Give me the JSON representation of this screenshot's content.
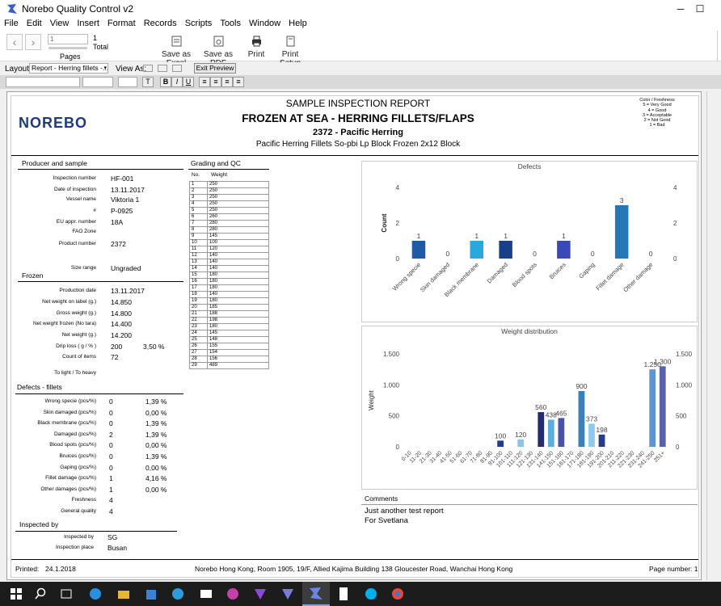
{
  "window": {
    "title": "Norebo Quality Control v2",
    "minimize": "─",
    "maximize": "☐"
  },
  "menu": [
    "File",
    "Edit",
    "View",
    "Insert",
    "Format",
    "Records",
    "Scripts",
    "Tools",
    "Window",
    "Help"
  ],
  "toolbar": {
    "record_value": "1",
    "record_total": "1",
    "total_label": "Total",
    "pages_label": "Pages",
    "save_excel": "Save as Excel",
    "save_pdf": "Save as PDF",
    "print": "Print",
    "print_setup": "Print Setup"
  },
  "layoutbar": {
    "layout_label": "Layout:",
    "layout_value": "Report - Herring fillets -...",
    "view_as": "View As:",
    "exit_preview": "Exit Preview"
  },
  "report": {
    "logo": "NOREBO",
    "heading": "SAMPLE INSPECTION REPORT",
    "title": "FROZEN AT SEA - HERRING FILLETS/FLAPS",
    "subtitle": "2372 - Pacific Herring",
    "product_line": "Pacific Herring Fillets So-pbi Lp Block Frozen   2x12 Block",
    "legend": [
      "Color / Freshness",
      "5 = Very Good",
      "4 = Good",
      "3 = Acceptable",
      "2 = Not Good",
      "1 = Bad"
    ],
    "producer_heading": "Producer and sample",
    "producer": [
      {
        "label": "Inspection number",
        "value": "HF-001"
      },
      {
        "label": "Date of inspection",
        "value": "13.11.2017"
      },
      {
        "label": "Vessel name",
        "value": "Viktoria 1"
      },
      {
        "label": "#",
        "value": "P-0925"
      },
      {
        "label": "EU appr. number",
        "value": "18A"
      },
      {
        "label": "FAO Zone",
        "value": ""
      },
      {
        "label": "Product number",
        "value": "2372"
      },
      {
        "label": "Size range",
        "value": "Ungraded"
      }
    ],
    "frozen_heading": "Frozen",
    "frozen": [
      {
        "label": "Production date",
        "value": "13.11.2017",
        "extra": ""
      },
      {
        "label": "Net weight on label (g.)",
        "value": "14.850",
        "extra": ""
      },
      {
        "label": "Gross weight (g.)",
        "value": "14.800",
        "extra": ""
      },
      {
        "label": "Net weight frozen (No tara)",
        "value": "14.400",
        "extra": ""
      },
      {
        "label": "Net weight (g.)",
        "value": "14.200",
        "extra": ""
      },
      {
        "label": "Drip loss ( g / % )",
        "value": "200",
        "extra": "3,50 %"
      },
      {
        "label": "Count of items",
        "value": "72",
        "extra": ""
      },
      {
        "label": "To light / To heavy",
        "value": "",
        "extra": ""
      }
    ],
    "defects_heading": "Defects - fillets",
    "defects": [
      {
        "label": "Wrong specie (pcs/%)",
        "value": "0",
        "pct": "1,39 %"
      },
      {
        "label": "Skin damaged (pcs/%)",
        "value": "0",
        "pct": "0,00 %"
      },
      {
        "label": "Black membrane (pcs/%)",
        "value": "0",
        "pct": "1,39 %"
      },
      {
        "label": "Damaged (pcs/%)",
        "value": "2",
        "pct": "1,39 %"
      },
      {
        "label": "Blood spots (pcs/%)",
        "value": "0",
        "pct": "0,00 %"
      },
      {
        "label": "Bruices (pcs/%)",
        "value": "0",
        "pct": "1,39 %"
      },
      {
        "label": "Gaping (pcs/%)",
        "value": "0",
        "pct": "0,00 %"
      },
      {
        "label": "Fillet damage (pcs/%)",
        "value": "1",
        "pct": "4,16 %"
      },
      {
        "label": "Other damages (pcs/%)",
        "value": "1",
        "pct": "0,00 %"
      },
      {
        "label": "Freshness",
        "value": "4",
        "pct": ""
      },
      {
        "label": "General quality",
        "value": "4",
        "pct": ""
      }
    ],
    "inspected_heading": "Inspected by",
    "inspected": [
      {
        "label": "Inspected by",
        "value": "SG"
      },
      {
        "label": "Inspection place",
        "value": "Busan"
      }
    ],
    "grading_heading": "Grading and QC",
    "grading_cols": [
      "No.",
      "Weight"
    ],
    "grading": [
      [
        "1",
        "250"
      ],
      [
        "2",
        "250"
      ],
      [
        "3",
        "250"
      ],
      [
        "4",
        "250"
      ],
      [
        "5",
        "250"
      ],
      [
        "6",
        "260"
      ],
      [
        "7",
        "280"
      ],
      [
        "8",
        "280"
      ],
      [
        "9",
        "145"
      ],
      [
        "10",
        "100"
      ],
      [
        "11",
        "120"
      ],
      [
        "12",
        "140"
      ],
      [
        "13",
        "140"
      ],
      [
        "14",
        "140"
      ],
      [
        "15",
        "180"
      ],
      [
        "16",
        "180"
      ],
      [
        "17",
        "180"
      ],
      [
        "18",
        "140"
      ],
      [
        "19",
        "180"
      ],
      [
        "20",
        "185"
      ],
      [
        "21",
        "188"
      ],
      [
        "22",
        "198"
      ],
      [
        "23",
        "180"
      ],
      [
        "24",
        "145"
      ],
      [
        "25",
        "148"
      ],
      [
        "26",
        "155"
      ],
      [
        "27",
        "154"
      ],
      [
        "28",
        "156"
      ],
      [
        "29",
        "489"
      ]
    ],
    "comments_label": "Comments",
    "comments": [
      "Just another test report",
      "For Svetlana"
    ],
    "footer": {
      "printed_label": "Printed:",
      "printed_date": "24.1.2018",
      "address": "Norebo Hong Kong, Room 1905, 19/F, Allied Kajima Building 138 Gloucester Road, Wanchai Hong Kong",
      "page": "Page number: 1"
    }
  },
  "chart_data": [
    {
      "type": "bar",
      "title": "Defects",
      "ylabel": "Count",
      "xlabel": "",
      "ylim": [
        0,
        4
      ],
      "yticks": [
        "0",
        "2",
        "4"
      ],
      "categories": [
        "Wrong specie",
        "Skin damaged",
        "Black membrane",
        "Damaged",
        "Blood spots",
        "Bruices",
        "Gaping",
        "Fillet damage",
        "Other damage"
      ],
      "values": [
        1,
        0,
        1,
        1,
        0,
        1,
        0,
        3,
        0
      ],
      "colors": [
        "#1f5aa6",
        "#2f7fc1",
        "#29a8e0",
        "#173f8a",
        "#3a6fb5",
        "#3b48b8",
        "#5f8fca",
        "#2577b5",
        "#6aa0cf"
      ]
    },
    {
      "type": "bar",
      "title": "Weight distribution",
      "ylabel": "Weight",
      "xlabel": "",
      "ylim": [
        0,
        1500
      ],
      "yticks": [
        "0",
        "500",
        "1.000",
        "1.500"
      ],
      "categories": [
        "0-10",
        "11-20",
        "21-30",
        "31-40",
        "41-50",
        "51-60",
        "61-70",
        "71-80",
        "81-90",
        "91-100",
        "101-110",
        "111-120",
        "121-130",
        "131-140",
        "141-150",
        "151-160",
        "161-170",
        "171-180",
        "181-190",
        "191-200",
        "201-210",
        "211-220",
        "221-230",
        "231-240",
        "241-250",
        "251+"
      ],
      "values": [
        0,
        0,
        0,
        0,
        0,
        0,
        0,
        0,
        0,
        100,
        0,
        120,
        0,
        560,
        438,
        465,
        0,
        900,
        373,
        198,
        0,
        0,
        0,
        0,
        1250,
        1300
      ],
      "labels": [
        "",
        "",
        "",
        "",
        "",
        "",
        "",
        "",
        "",
        "100",
        "",
        "120",
        "",
        "560",
        "438",
        "465",
        "",
        "900",
        "373",
        "198",
        "",
        "",
        "",
        "",
        "1.250",
        "1.300"
      ],
      "colors": [
        "#1f5aa6",
        "#1f5aa6",
        "#1f5aa6",
        "#1f5aa6",
        "#1f5aa6",
        "#1f5aa6",
        "#1f5aa6",
        "#1f5aa6",
        "#1f5aa6",
        "#1e3c96",
        "#1f5aa6",
        "#8ec3e6",
        "#1f5aa6",
        "#232c6e",
        "#5aaee0",
        "#4a52a8",
        "#1f5aa6",
        "#3b80b8",
        "#8ecaf0",
        "#2a3a8a",
        "#1f5aa6",
        "#1f5aa6",
        "#1f5aa6",
        "#1f5aa6",
        "#5f94d0",
        "#5b63a8"
      ]
    }
  ]
}
